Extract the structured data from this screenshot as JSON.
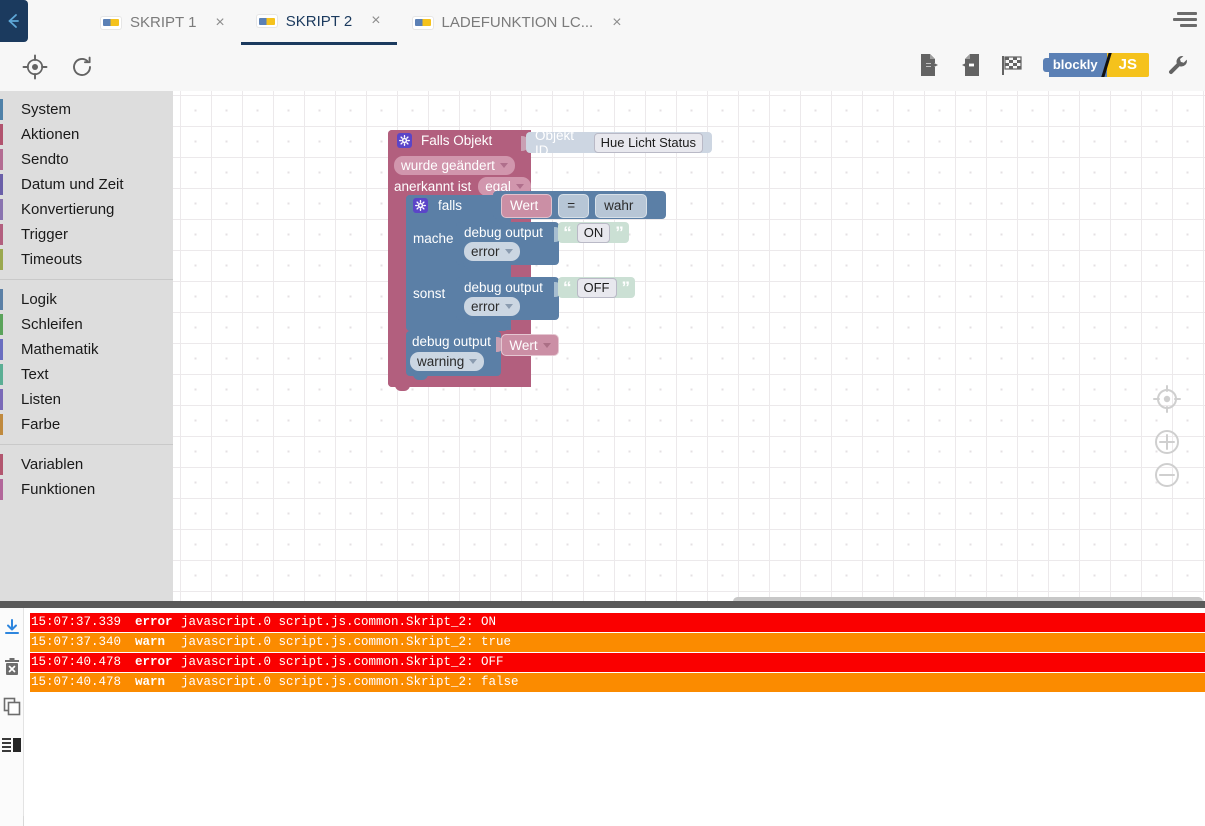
{
  "window": {
    "back_label": "back-arrow",
    "menu_label": "menu"
  },
  "tabs": [
    {
      "label": "SKRIPT 1",
      "icon": "blockly-icon",
      "close": "×",
      "active": false
    },
    {
      "label": "SKRIPT 2",
      "icon": "blockly-icon",
      "close": "×",
      "active": true
    },
    {
      "label": "LADEFUNKTION LC...",
      "icon": "blockly-icon",
      "close": "×",
      "active": false
    }
  ],
  "toolbar": {
    "left": [
      {
        "name": "locate-target-icon",
        "title": "Zentrieren"
      },
      {
        "name": "refresh-icon",
        "title": "Neu laden"
      }
    ],
    "right": [
      {
        "name": "export-icon",
        "title": "Exportieren"
      },
      {
        "name": "import-icon",
        "title": "Importieren"
      },
      {
        "name": "checkered-flag-icon",
        "title": "Debug"
      },
      {
        "name": "wrench-icon",
        "title": "Einstellungen"
      }
    ],
    "lang_toggle": {
      "left_label": "blockly",
      "right_label": "JS",
      "left_color": "#5b80b5",
      "right_color": "#f5c21c"
    }
  },
  "toolbox": {
    "groups": [
      {
        "items": [
          {
            "label": "System",
            "color": "#4f81a8"
          },
          {
            "label": "Aktionen",
            "color": "#b1536e"
          },
          {
            "label": "Sendto",
            "color": "#b36c92"
          },
          {
            "label": "Datum und Zeit",
            "color": "#6a5fa8"
          },
          {
            "label": "Konvertierung",
            "color": "#8a74b0"
          },
          {
            "label": "Trigger",
            "color": "#b25f7e"
          },
          {
            "label": "Timeouts",
            "color": "#9aa84f"
          }
        ]
      },
      {
        "items": [
          {
            "label": "Logik",
            "color": "#5b80a6"
          },
          {
            "label": "Schleifen",
            "color": "#5ba35b"
          },
          {
            "label": "Mathematik",
            "color": "#6a6ec0"
          },
          {
            "label": "Text",
            "color": "#5bae94"
          },
          {
            "label": "Listen",
            "color": "#7b6ab8"
          },
          {
            "label": "Farbe",
            "color": "#c08a3e"
          }
        ]
      },
      {
        "items": [
          {
            "label": "Variablen",
            "color": "#b2566f"
          },
          {
            "label": "Funktionen",
            "color": "#b2679a"
          }
        ]
      }
    ]
  },
  "workspace": {
    "blocks": {
      "trigger": {
        "title": "Falls Objekt",
        "dropdown_change": "wurde geändert",
        "ack_label": "anerkannt ist",
        "ack_value": "egal",
        "objekt_id_label": "Objekt ID",
        "objekt_id_value": "Hue Licht Status"
      },
      "if_block": {
        "title": "falls",
        "cond_left": "Wert",
        "cond_op": "=",
        "cond_right": "wahr",
        "do_label": "mache",
        "else_label": "sonst"
      },
      "debug_on": {
        "label": "debug output",
        "severity": "error",
        "text": "ON",
        "quote_open": "“",
        "quote_close": "”"
      },
      "debug_off": {
        "label": "debug output",
        "severity": "error",
        "text": "OFF",
        "quote_open": "“",
        "quote_close": "”"
      },
      "debug_value": {
        "label": "debug output",
        "severity": "warning",
        "value": "Wert"
      }
    },
    "controls": [
      {
        "name": "center-workspace-icon"
      },
      {
        "name": "zoom-in-icon"
      },
      {
        "name": "zoom-out-icon"
      },
      {
        "name": "trash-icon"
      }
    ]
  },
  "log": {
    "tools": [
      {
        "name": "download-log-icon"
      },
      {
        "name": "clear-log-icon"
      },
      {
        "name": "copy-log-icon"
      },
      {
        "name": "log-layout-icon"
      }
    ],
    "columns": [
      "timestamp",
      "severity",
      "message"
    ],
    "rows": [
      {
        "timestamp": "15:07:37.339",
        "severity": "error",
        "message": "javascript.0 script.js.common.Skript_2: ON",
        "color": "#fa0000"
      },
      {
        "timestamp": "15:07:37.340",
        "severity": "warn",
        "message": "javascript.0 script.js.common.Skript_2: true",
        "color": "#fb8b00"
      },
      {
        "timestamp": "15:07:40.478",
        "severity": "error",
        "message": "javascript.0 script.js.common.Skript_2: OFF",
        "color": "#fa0000"
      },
      {
        "timestamp": "15:07:40.478",
        "severity": "warn",
        "message": "javascript.0 script.js.common.Skript_2: false",
        "color": "#fb8b00"
      }
    ]
  }
}
